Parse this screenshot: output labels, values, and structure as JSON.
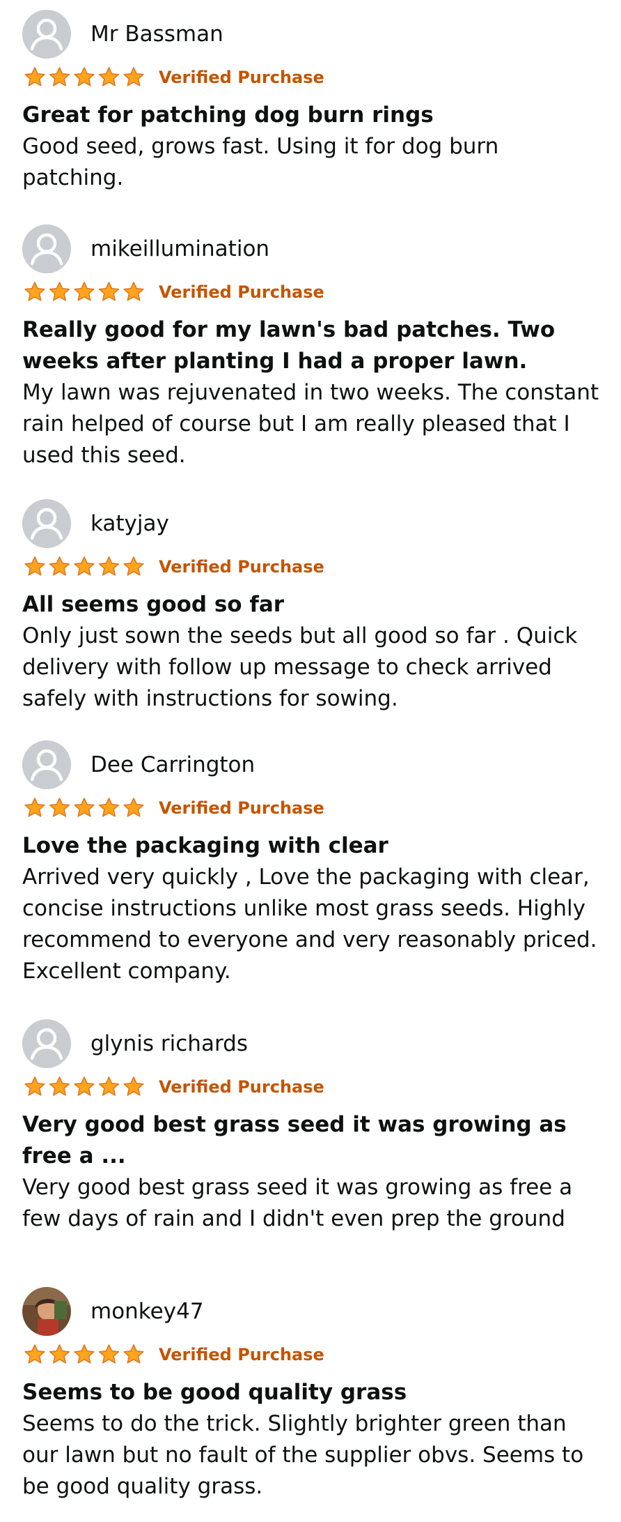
{
  "colors": {
    "star_fill": "#ffa41c",
    "star_stroke": "#de7921",
    "verified": "#c45500",
    "text": "#0f1111",
    "avatar_bg": "#c9cdd1"
  },
  "reviews": [
    {
      "reviewer": "Mr Bassman",
      "avatar_icon": "default-user-icon",
      "rating": 5,
      "verified": "Verified Purchase",
      "title": "Great for patching dog burn rings",
      "body": "Good seed, grows fast. Using it for dog burn patching."
    },
    {
      "reviewer": "mikeillumination",
      "avatar_icon": "default-user-icon",
      "rating": 5,
      "verified": "Verified Purchase",
      "title": "Really good for my lawn's bad patches. Two weeks after planting I had a proper lawn.",
      "body": "My lawn was rejuvenated in two weeks. The constant rain helped of course but I am really pleased that I used this seed."
    },
    {
      "reviewer": "katyjay",
      "avatar_icon": "default-user-icon",
      "rating": 5,
      "verified": "Verified Purchase",
      "title": "All seems good so far",
      "body": "Only just sown the seeds but all good so far . Quick delivery with follow up message to check arrived safely with instructions for sowing."
    },
    {
      "reviewer": "Dee Carrington",
      "avatar_icon": "default-user-icon",
      "rating": 5,
      "verified": "Verified Purchase",
      "title": "Love the packaging with clear",
      "body": "Arrived very quickly , Love the packaging with clear, concise instructions unlike most grass seeds. Highly recommend to everyone and very reasonably priced. Excellent company."
    },
    {
      "reviewer": "glynis richards",
      "avatar_icon": "default-user-icon",
      "rating": 5,
      "verified": "Verified Purchase",
      "title": "Very good best grass seed it was growing as free a ...",
      "body": "Very good best grass seed it was growing as free a few days of rain and I didn't even prep the ground"
    },
    {
      "reviewer": "monkey47",
      "avatar_icon": "profile-photo-icon",
      "rating": 5,
      "verified": "Verified Purchase",
      "title": "Seems to be good quality grass",
      "body": "Seems to do the trick. Slightly brighter green than our lawn but no fault of the supplier obvs. Seems to be good quality grass."
    }
  ]
}
